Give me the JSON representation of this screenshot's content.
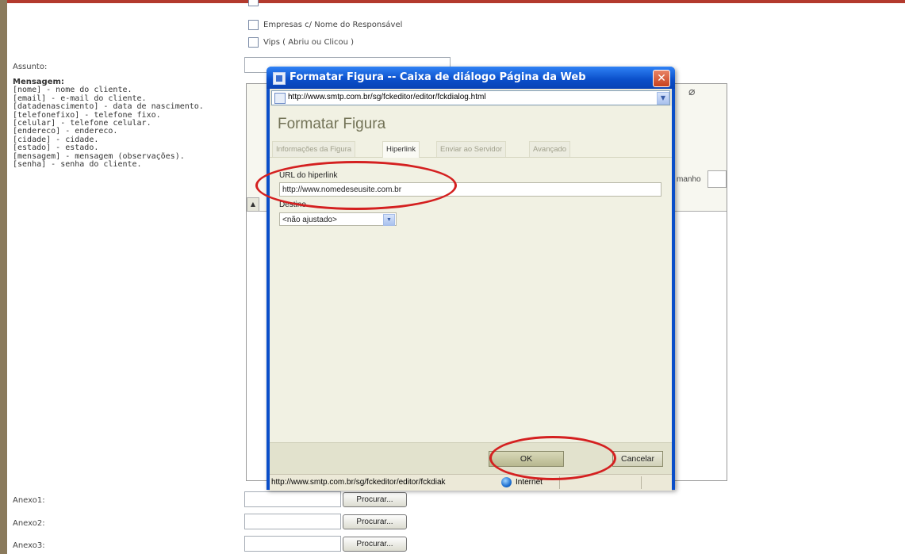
{
  "recipient_options": [
    {
      "label": "Empresas c/ Nome do Responsável"
    },
    {
      "label": "Vips ( Abriu ou Clicou )"
    }
  ],
  "form": {
    "assunto_label": "Assunto:",
    "mensagem_label": "Mensagem:",
    "anexos": [
      {
        "label": "Anexo1:",
        "button": "Procurar..."
      },
      {
        "label": "Anexo2:",
        "button": "Procurar..."
      },
      {
        "label": "Anexo3:",
        "button": "Procurar..."
      }
    ]
  },
  "placeholders": [
    "[nome] - nome do cliente.",
    "[email] - e-mail do cliente.",
    "[datadenascimento] - data de nascimento.",
    "[telefonefixo] - telefone fixo.",
    "[celular] - telefone celular.",
    "[endereco] - endereco.",
    "[cidade] - cidade.",
    "[estado] - estado.",
    "[mensagem] - mensagem (observações).",
    "[senha] - senha do cliente."
  ],
  "editor": {
    "tamanho_label": "manho"
  },
  "dialog": {
    "title": "Formatar Figura -- Caixa de diálogo Página da Web",
    "close_glyph": "✕",
    "address": "http://www.smtp.com.br/sg/fckeditor/editor/fckdialog.html",
    "heading": "Formatar Figura",
    "tabs": [
      {
        "label": "Informações da Figura",
        "active": false
      },
      {
        "label": "Hiperlink",
        "active": true
      },
      {
        "label": "Enviar ao Servidor",
        "active": false
      },
      {
        "label": "Avançado",
        "active": false
      }
    ],
    "url_label": "URL do hiperlink",
    "url_value": "http://www.nomedeseusite.com.br",
    "destino_label": "Destino",
    "destino_value": "<não ajustado>",
    "ok_label": "OK",
    "cancel_label": "Cancelar",
    "status_url": "http://www.smtp.com.br/sg/fckeditor/editor/fckdiak",
    "status_zone": "Internet"
  },
  "colors": {
    "title_blue": "#0a4ec9",
    "highlight_red": "#d42020",
    "dialog_bg": "#f1f1e3"
  }
}
